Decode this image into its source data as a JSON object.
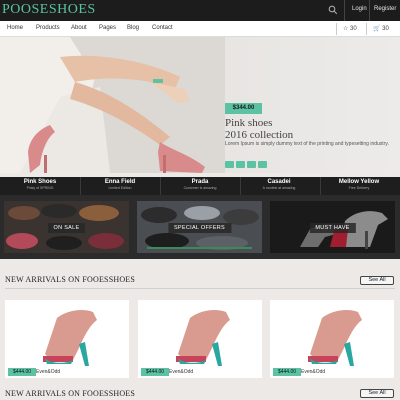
{
  "header": {
    "logo": "POOSESHOES",
    "login": "Login",
    "register": "Register"
  },
  "nav": {
    "items": [
      "Home",
      "Products",
      "About",
      "Pages",
      "Blog",
      "Contact"
    ],
    "wishlist": "☆ 30",
    "cart": "🛒 30"
  },
  "hero": {
    "price": "$344.00",
    "title_line1": "Pink shoes",
    "title_line2": "2016 collection",
    "description": "Lorem Ipsum is simply dummy text of the printing and typesetting industry."
  },
  "categories": [
    {
      "name": "Pink Shoes",
      "sub": "Pinky of SPRING"
    },
    {
      "name": "Enna Field",
      "sub": "Limited Edition"
    },
    {
      "name": "Prada",
      "sub": "Customer is amazing"
    },
    {
      "name": "Casadei",
      "sub": "A modest at amazing"
    },
    {
      "name": "Mellow Yellow",
      "sub": "Free Delivery"
    }
  ],
  "promos": [
    "ON SALE",
    "SPECIAL OFFERS",
    "MUST HAVE"
  ],
  "sections": {
    "new_arrivals_1": "NEW ARRIVALS ON FOOESSHOES",
    "new_arrivals_2": "NEW ARRIVALS ON FOOESSHOES",
    "see_all": "See All"
  },
  "products": [
    {
      "price": "$444.00",
      "store": "Even&Odd"
    },
    {
      "price": "$444.00",
      "store": "Even&Odd"
    },
    {
      "price": "$444.00",
      "store": "Even&Odd"
    }
  ],
  "colors": {
    "accent": "#5bc2a3",
    "topbar": "#1c1c1c",
    "shoe_pink": "#d98a8a",
    "shoe_sole": "#2aa8a0"
  }
}
